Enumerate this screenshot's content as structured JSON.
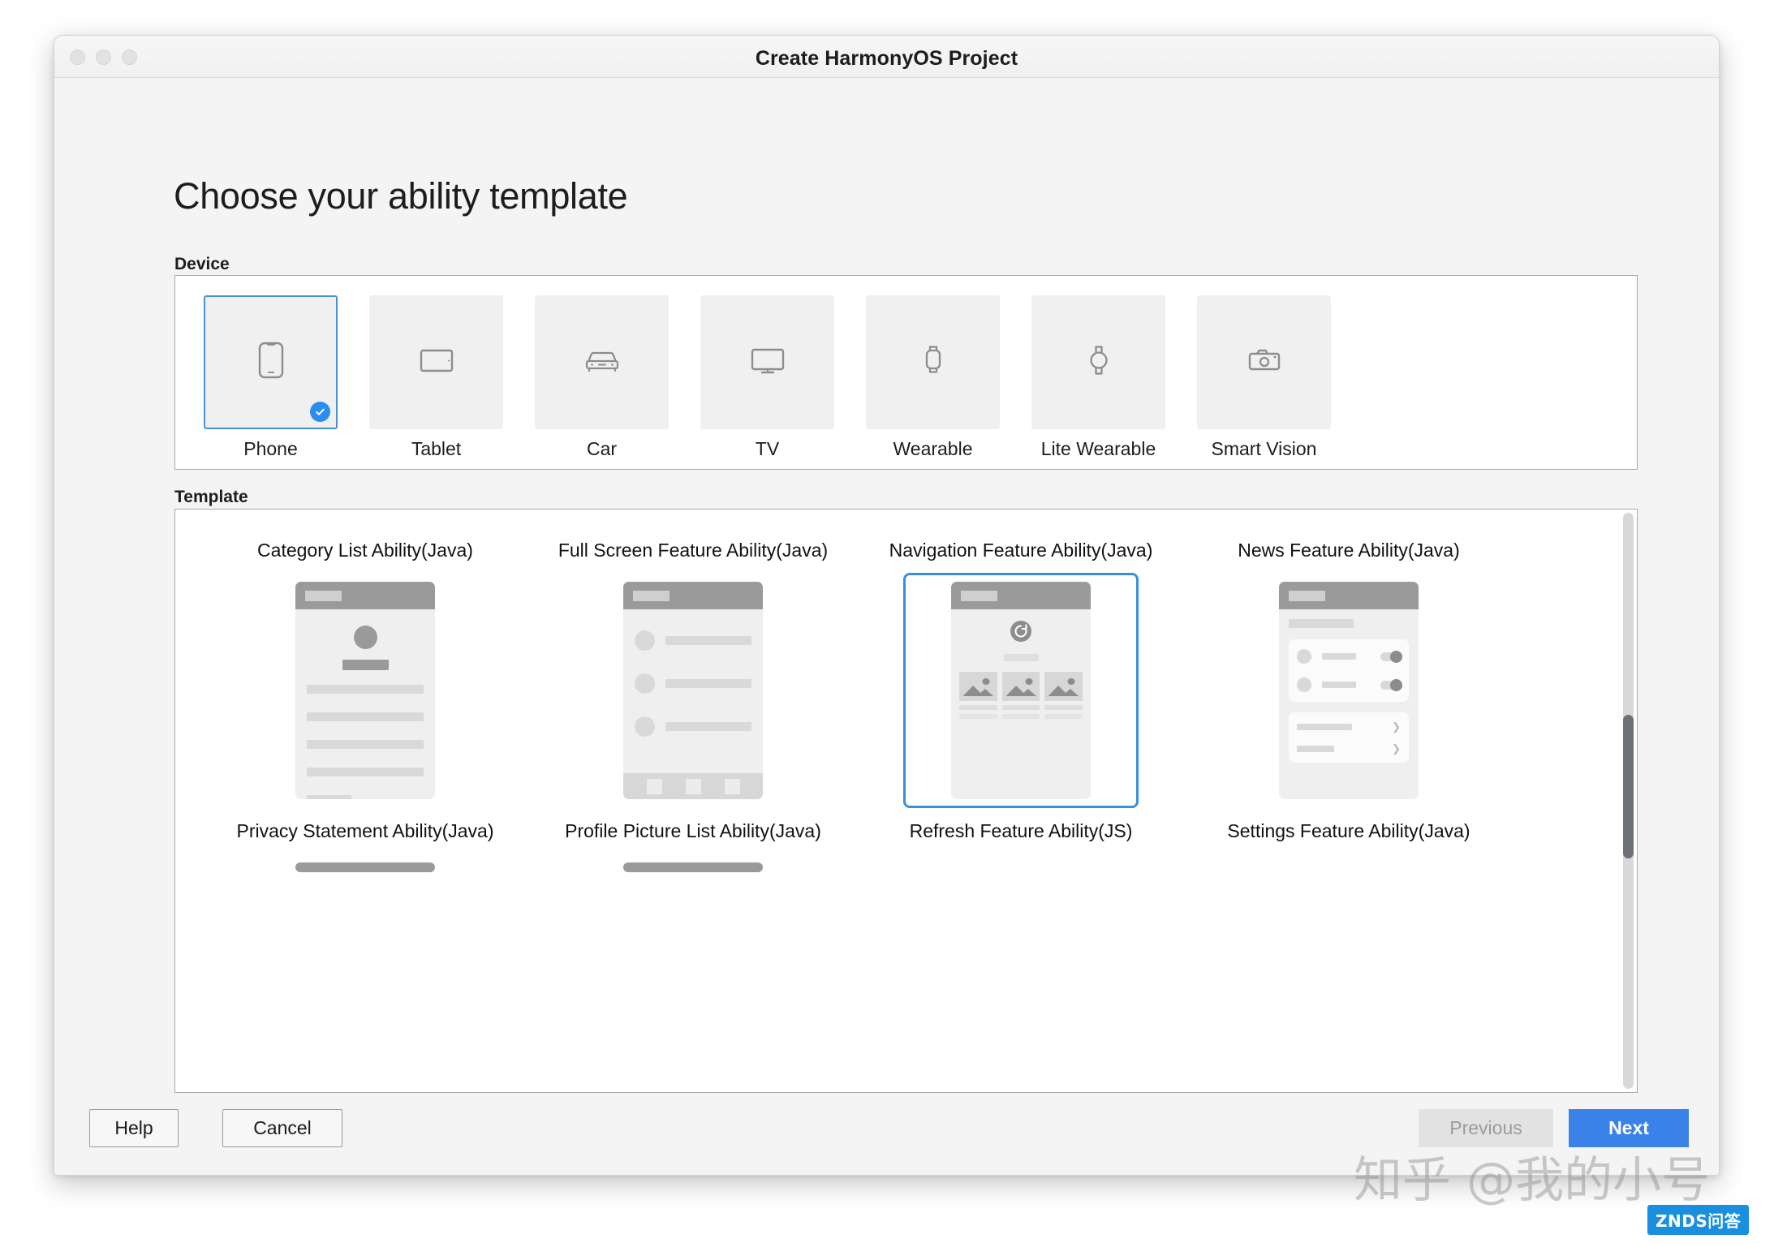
{
  "window": {
    "title": "Create HarmonyOS Project",
    "traffic_lights": [
      "close",
      "minimize",
      "maximize"
    ]
  },
  "page": {
    "heading": "Choose your ability template"
  },
  "device_section": {
    "label": "Device",
    "selected": "Phone",
    "items": [
      {
        "label": "Phone",
        "icon": "phone-icon",
        "selected": true
      },
      {
        "label": "Tablet",
        "icon": "tablet-icon",
        "selected": false
      },
      {
        "label": "Car",
        "icon": "car-icon",
        "selected": false
      },
      {
        "label": "TV",
        "icon": "tv-icon",
        "selected": false
      },
      {
        "label": "Wearable",
        "icon": "watch-square-icon",
        "selected": false
      },
      {
        "label": "Lite Wearable",
        "icon": "watch-round-icon",
        "selected": false
      },
      {
        "label": "Smart Vision",
        "icon": "camera-icon",
        "selected": false
      }
    ]
  },
  "template_section": {
    "label": "Template",
    "selected": "Navigation Feature Ability(Java)",
    "items": [
      {
        "label": "Category List Ability(Java)",
        "preview": "profile-list-preview",
        "selected": false
      },
      {
        "label": "Full Screen Feature Ability(Java)",
        "preview": "list-tabbar-preview",
        "selected": false
      },
      {
        "label": "Navigation Feature Ability(Java)",
        "preview": "refresh-grid-preview",
        "selected": true
      },
      {
        "label": "News Feature Ability(Java)",
        "preview": "settings-toggle-preview",
        "selected": false
      },
      {
        "label": "Privacy Statement Ability(Java)",
        "preview": "clipped-preview",
        "selected": false
      },
      {
        "label": "Profile Picture List Ability(Java)",
        "preview": "clipped-preview",
        "selected": false
      },
      {
        "label": "Refresh Feature Ability(JS)",
        "preview": "clipped-preview",
        "selected": false
      },
      {
        "label": "Settings Feature Ability(Java)",
        "preview": "clipped-preview",
        "selected": false
      }
    ],
    "scrollbar": {
      "visible": true
    }
  },
  "footer": {
    "help": "Help",
    "cancel": "Cancel",
    "previous": "Previous",
    "previous_disabled": true,
    "next": "Next"
  },
  "watermark": {
    "text": "知乎 @我的小号",
    "badge": "ZNDS问答"
  },
  "colors": {
    "accent_blue": "#3b82e8",
    "selection_border": "#4a90d9",
    "check_badge": "#2d8cf0",
    "panel_bg": "#ffffff",
    "window_bg": "#f4f4f4",
    "tile_bg": "#f0f0f0"
  }
}
